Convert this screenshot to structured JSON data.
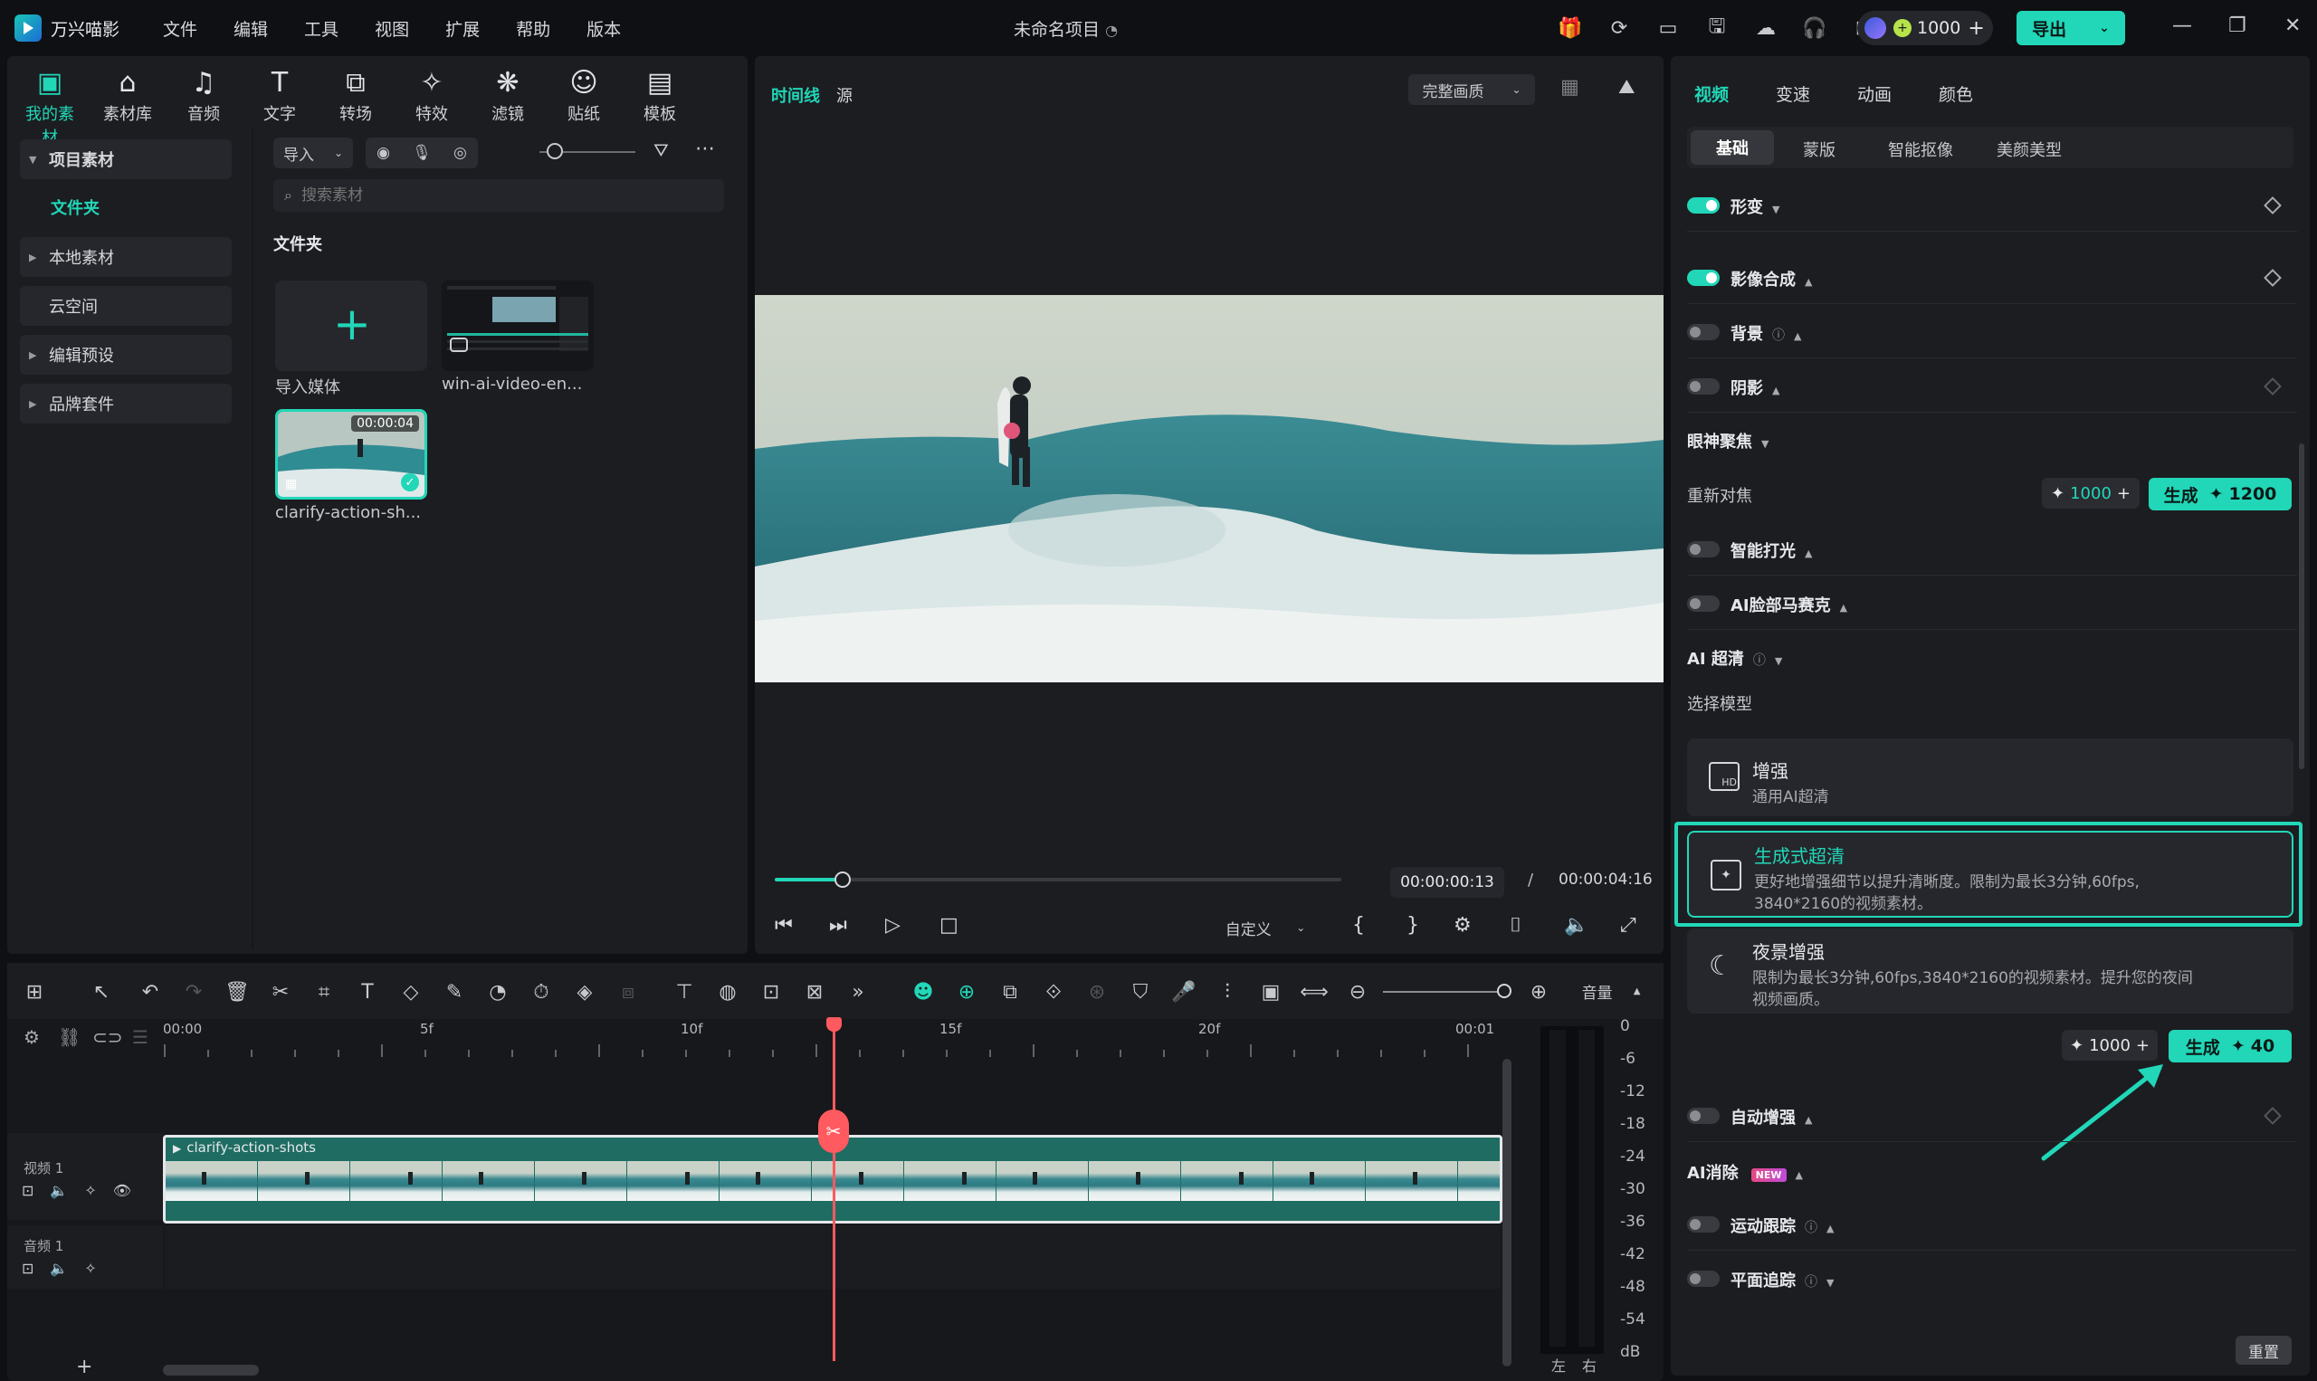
{
  "app": {
    "name": "万兴喵影",
    "project_title": "未命名项目"
  },
  "menu": [
    "文件",
    "编辑",
    "工具",
    "视图",
    "扩展",
    "帮助",
    "版本"
  ],
  "top_credits": "1000",
  "export_label": "导出",
  "toolbar": [
    {
      "label": "我的素材",
      "icon": "media-icon"
    },
    {
      "label": "素材库",
      "icon": "store-icon"
    },
    {
      "label": "音频",
      "icon": "music-icon"
    },
    {
      "label": "文字",
      "icon": "text-icon"
    },
    {
      "label": "转场",
      "icon": "transition-icon"
    },
    {
      "label": "特效",
      "icon": "effects-icon"
    },
    {
      "label": "滤镜",
      "icon": "filter-icon"
    },
    {
      "label": "贴纸",
      "icon": "sticker-icon"
    },
    {
      "label": "模板",
      "icon": "template-icon"
    }
  ],
  "sidebar": {
    "project_media": "项目素材",
    "folder": "文件夹",
    "local_media": "本地素材",
    "cloud": "云空间",
    "presets": "编辑预设",
    "brand": "品牌套件"
  },
  "media": {
    "import_label": "导入",
    "search_placeholder": "搜索素材",
    "folder_title": "文件夹",
    "items": [
      {
        "label": "导入媒体"
      },
      {
        "label": "win-ai-video-en..."
      },
      {
        "label": "clarify-action-sh...",
        "duration": "00:00:04"
      }
    ]
  },
  "preview": {
    "tab_timeline": "时间线",
    "tab_source": "源",
    "quality": "完整画质",
    "current_time": "00:00:00:13",
    "separator": "/",
    "total_time": "00:00:04:16",
    "custom_label": "自定义",
    "progress": 0.12
  },
  "right_panel": {
    "tabs": [
      "视频",
      "变速",
      "动画",
      "颜色"
    ],
    "subtabs": [
      "基础",
      "蒙版",
      "智能抠像",
      "美颜美型"
    ],
    "rows": {
      "transform": "形变",
      "compositing": "影像合成",
      "background": "背景",
      "shadow": "阴影",
      "eye_focus": "眼神聚焦",
      "refocus": "重新对焦",
      "smart_light": "智能打光",
      "face_mosaic": "AI脸部马赛克",
      "ai_hd": "AI 超清",
      "choose_model": "选择模型",
      "auto_enhance": "自动增强",
      "ai_erase": "AI消除",
      "new_badge": "NEW",
      "motion_track": "运动跟踪",
      "plane_track": "平面追踪"
    },
    "refocus_cost": "1000",
    "refocus_gen": "生成",
    "refocus_gen_cost": "1200",
    "models": [
      {
        "title": "增强",
        "desc": "通用AI超清"
      },
      {
        "title": "生成式超清",
        "desc": "更好地增强细节以提升清晰度。限制为最长3分钟,60fps,",
        "desc2": "3840*2160的视频素材。"
      },
      {
        "title": "夜景增强",
        "desc": "限制为最长3分钟,60fps,3840*2160的视频素材。提升您的夜间",
        "desc2": "视频画质。"
      }
    ],
    "hd_cost": "1000",
    "hd_gen": "生成",
    "hd_gen_cost": "40",
    "reset": "重置"
  },
  "timeline": {
    "ruler": [
      "00:00",
      "5f",
      "10f",
      "15f",
      "20f",
      "00:01"
    ],
    "volume_label": "音量",
    "video_track": "视频 1",
    "audio_track": "音频 1",
    "clip_name": "clarify-action-shots",
    "db_marks": [
      "0",
      "-6",
      "-12",
      "-18",
      "-24",
      "-30",
      "-36",
      "-42",
      "-48",
      "-54",
      "dB"
    ],
    "lr": [
      "左",
      "右"
    ]
  },
  "colors": {
    "accent": "#21d7b8",
    "playhead": "#ff5a5f"
  }
}
